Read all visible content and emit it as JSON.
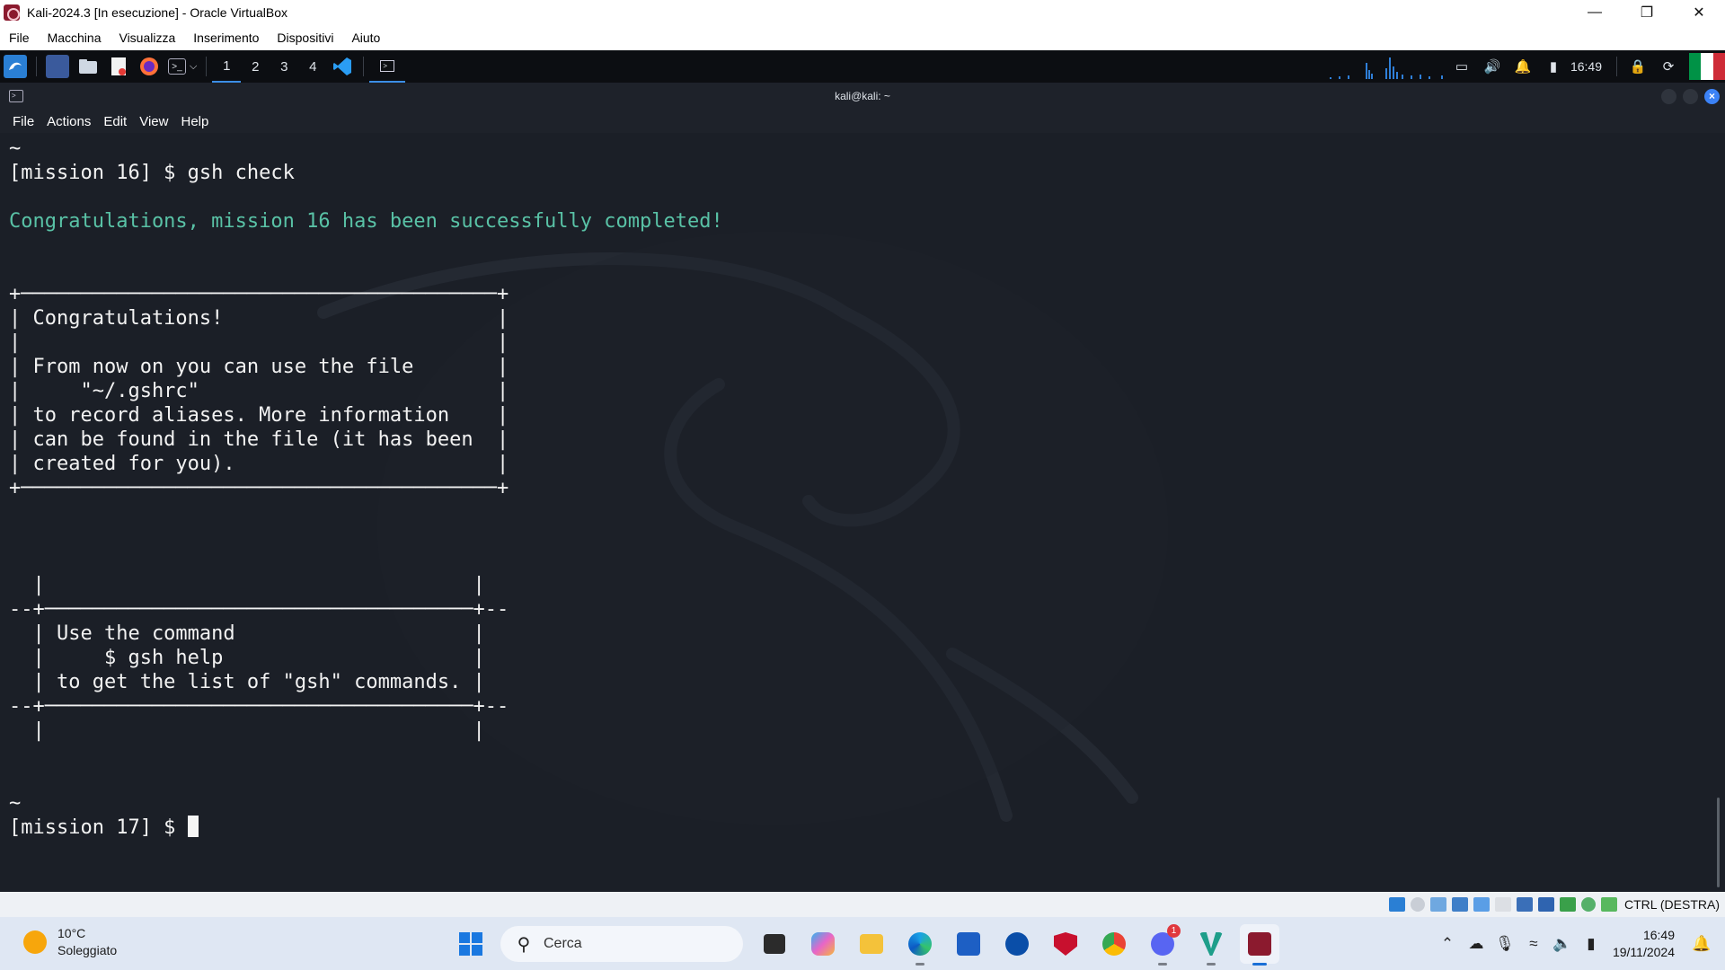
{
  "vbox": {
    "title": "Kali-2024.3 [In esecuzione] - Oracle VirtualBox",
    "menu": [
      "File",
      "Macchina",
      "Visualizza",
      "Inserimento",
      "Dispositivi",
      "Aiuto"
    ],
    "host_key": "CTRL (DESTRA)"
  },
  "kali_panel": {
    "workspaces": [
      "1",
      "2",
      "3",
      "4"
    ],
    "active_workspace": "1",
    "time": "16:49"
  },
  "terminal": {
    "title": "kali@kali: ~",
    "menu": [
      "File",
      "Actions",
      "Edit",
      "View",
      "Help"
    ],
    "lines": [
      "~",
      "[mission 16] $ gsh check",
      "",
      "Congratulations, mission 16 has been successfully completed!",
      "",
      "",
      "+────────────────────────────────────────+",
      "| Congratulations!                       |",
      "|                                        |",
      "| From now on you can use the file       |",
      "|     \"~/.gshrc\"                         |",
      "| to record aliases. More information    |",
      "| can be found in the file (it has been  |",
      "| created for you).                      |",
      "+────────────────────────────────────────+",
      "",
      "",
      "",
      "  |                                    |",
      "--+────────────────────────────────────+--",
      "  | Use the command                    |",
      "  |     $ gsh help                     |",
      "  | to get the list of \"gsh\" commands. |",
      "--+────────────────────────────────────+--",
      "  |                                    |",
      "",
      "",
      "~"
    ],
    "success_line_index": 3,
    "prompt": "[mission 17] $ "
  },
  "taskbar": {
    "weather_temp": "10°C",
    "weather_desc": "Soleggiato",
    "search_placeholder": "Cerca",
    "clock_time": "16:49",
    "clock_date": "19/11/2024",
    "discord_badge": "1"
  }
}
